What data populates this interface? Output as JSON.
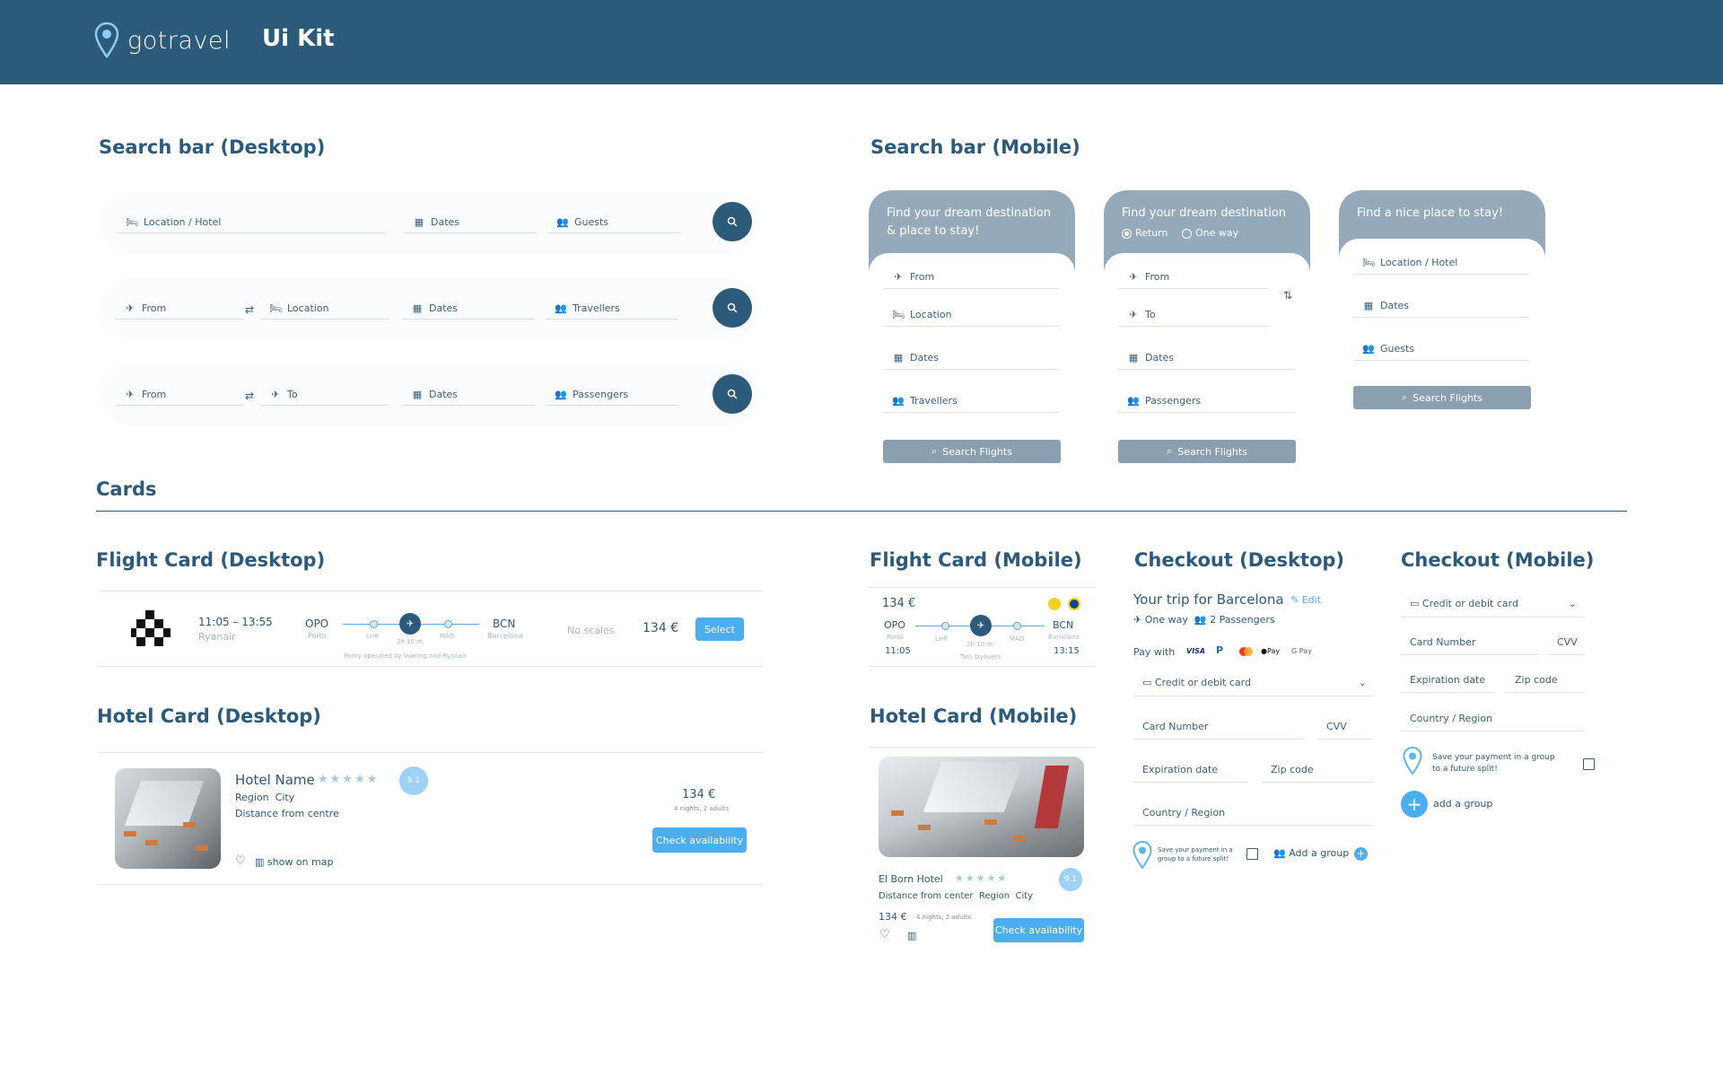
{
  "header": {
    "brand": "gotravel",
    "title": "Ui Kit",
    "color": "#2b5a7a"
  },
  "sections": {
    "search_desktop": "Search bar (Desktop)",
    "search_mobile": "Search bar (Mobile)",
    "cards": "Cards",
    "flight_desktop": "Flight Card (Desktop)",
    "flight_mobile": "Flight Card (Mobile)",
    "checkout_desktop": "Checkout (Desktop)",
    "checkout_mobile": "Checkout (Mobile)",
    "hotel_desktop": "Hotel Card (Desktop)",
    "hotel_mobile": "Hotel Card (Mobile)"
  },
  "search_desktop": {
    "bar1": {
      "location": "Location / Hotel",
      "dates": "Dates",
      "guests": "Guests"
    },
    "bar2": {
      "from": "From",
      "location": "Location",
      "dates": "Dates",
      "travellers": "Travellers"
    },
    "bar3": {
      "from": "From",
      "to": "To",
      "dates": "Dates",
      "passengers": "Passengers"
    }
  },
  "search_mobile": {
    "m1": {
      "head": "Find your dream destination & place to stay!",
      "from": "From",
      "location": "Location",
      "dates": "Dates",
      "travellers": "Travellers",
      "button": "Search Flights"
    },
    "m2": {
      "head": "Find your dream destination",
      "return": "Return",
      "oneway": "One way",
      "from": "From",
      "to": "To",
      "dates": "Dates",
      "passengers": "Passengers",
      "button": "Search Flights"
    },
    "m3": {
      "head": "Find a nice place to stay!",
      "location": "Location / Hotel",
      "dates": "Dates",
      "guests": "Guests",
      "button": "Search Flights"
    }
  },
  "flight_desktop": {
    "time": "11:05 – 13:55",
    "airline": "Ryanair",
    "from_code": "OPO",
    "from_city": "Porto",
    "stop1": "LHR",
    "duration": "2h 10 m",
    "stop2": "MAD",
    "to_code": "BCN",
    "to_city": "Barcelona",
    "operated": "Partly operated by Vueling and Ryanair",
    "scales": "No scales",
    "price": "134 €",
    "select": "Select"
  },
  "flight_mobile": {
    "price": "134 €",
    "from_code": "OPO",
    "from_city": "Porto",
    "dep": "11:05",
    "stop1": "LHR",
    "duration": "2h 10 m",
    "stop2": "MAD",
    "layovers": "Two layovers",
    "to_code": "BCN",
    "to_city": "Barcelona",
    "arr": "13:15"
  },
  "hotel_desktop": {
    "name": "Hotel Name",
    "stars": "★★★★★",
    "rating": "9.1",
    "region": "Region",
    "city": "City",
    "distance": "Distance from centre",
    "map": "show on map",
    "price": "134 €",
    "nights": "4 nights, 2 adults",
    "button": "Check availability"
  },
  "hotel_mobile": {
    "name": "El Born Hotel",
    "stars": "★★★★★",
    "rating": "9.1",
    "distance": "Distance from center",
    "region": "Region",
    "city": "City",
    "price": "134 €",
    "nights": "4 nights, 2 adults",
    "button": "Check availability"
  },
  "checkout_desktop": {
    "trip": "Your trip for Barcelona",
    "edit": "Edit",
    "oneway": "One way",
    "passengers": "2 Passengers",
    "paywith": "Pay with",
    "visa": "VISA",
    "applepay": "Pay",
    "gpay": "G Pay",
    "method": "Credit or debit card",
    "card": "Card Number",
    "cvv": "CVV",
    "exp": "Expiration date",
    "zip": "Zip code",
    "country": "Country / Region",
    "save": "Save your payment in a group to a future split!",
    "addgroup": "Add a group"
  },
  "checkout_mobile": {
    "method": "Credit or debit card",
    "card": "Card Number",
    "cvv": "CVV",
    "exp": "Expiration date",
    "zip": "Zip code",
    "country": "Country / Region",
    "save": "Save your payment in a group to a future split!",
    "addgroup": "add a group"
  }
}
